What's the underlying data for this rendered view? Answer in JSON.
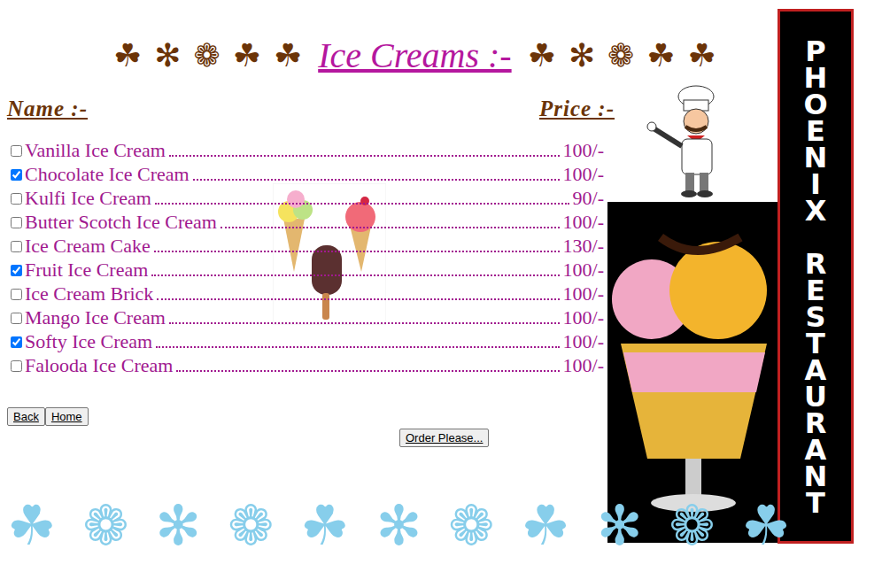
{
  "title": "Ice Creams :-",
  "decorations_left": [
    "☘",
    "✻",
    "❁",
    "☘",
    "☘"
  ],
  "decorations_right": [
    "☘",
    "✻",
    "❁",
    "☘",
    "☘"
  ],
  "columns": {
    "name": "Name :-",
    "price": "Price :-"
  },
  "items": [
    {
      "name": "Vanilla Ice Cream",
      "price": "100/-",
      "checked": false
    },
    {
      "name": "Chocolate Ice Cream",
      "price": "100/-",
      "checked": true
    },
    {
      "name": "Kulfi Ice Cream",
      "price": "90/-",
      "checked": false
    },
    {
      "name": "Butter Scotch Ice Cream",
      "price": "100/-",
      "checked": false
    },
    {
      "name": "Ice Cream Cake",
      "price": "130/-",
      "checked": false
    },
    {
      "name": "Fruit Ice Cream",
      "price": "100/-",
      "checked": true
    },
    {
      "name": "Ice Cream Brick",
      "price": "100/-",
      "checked": false
    },
    {
      "name": "Mango Ice Cream",
      "price": "100/-",
      "checked": false
    },
    {
      "name": "Softy Ice Cream",
      "price": "100/-",
      "checked": true
    },
    {
      "name": "Falooda Ice Cream",
      "price": "100/-",
      "checked": false
    }
  ],
  "nav_buttons": [
    "Back",
    "Home"
  ],
  "order_button": "Order Please...",
  "brand": "PHOENIX RESTAURANT",
  "footer_decorations": [
    "☘",
    "❁",
    "✻",
    "❁",
    "☘",
    "✻",
    "❁",
    "☘",
    "✻",
    "❁",
    "☘"
  ]
}
